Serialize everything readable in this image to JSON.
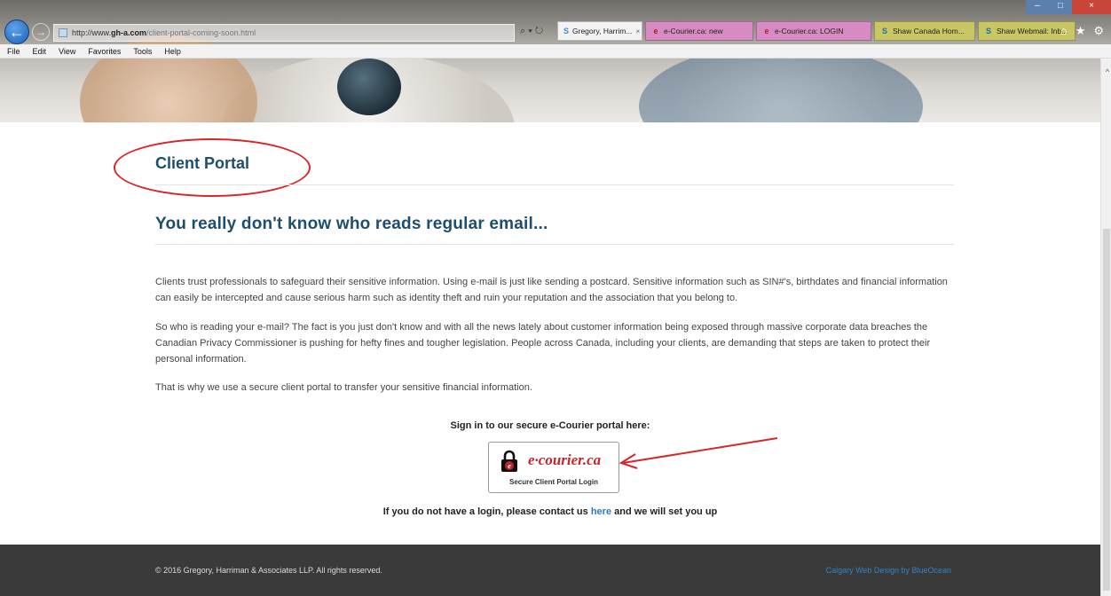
{
  "browser": {
    "url_scheme": "http://www.",
    "url_host": "gh-a.com",
    "url_path": "/client-portal-coming-soon.html",
    "tabs": [
      {
        "label": "Gregory, Harrim...",
        "icon": "S",
        "close": "×"
      },
      {
        "label": "e-Courier.ca: new",
        "icon": "e"
      },
      {
        "label": "e-Courier.ca: LOGIN",
        "icon": "e"
      },
      {
        "label": "Shaw Canada Hom...",
        "icon": "S"
      },
      {
        "label": "Shaw Webmail: Inb...",
        "icon": "S"
      }
    ],
    "menu": [
      "File",
      "Edit",
      "View",
      "Favorites",
      "Tools",
      "Help"
    ],
    "address_tools": "⌕ ▾ ↻",
    "right_icons": {
      "home": "⌂",
      "favorites": "★",
      "settings": "⚙"
    },
    "window_controls": {
      "minimize": "–",
      "maximize": "□",
      "close": "×"
    }
  },
  "page": {
    "portal_title": "Client Portal",
    "headline": "You really don't know who reads regular email...",
    "paragraphs": [
      "Clients trust professionals to safeguard their sensitive information. Using e-mail is just like sending a postcard. Sensitive information such as SIN#'s, birthdates and financial information can easily be intercepted and cause serious harm such as identity theft and ruin your reputation and the association that you belong to.",
      "So who is reading your e-mail? The fact is you just don't know and with all the news lately about customer information being exposed through massive corporate data breaches the Canadian Privacy Commissioner is pushing for hefty fines and tougher legislation. People across Canada, including your clients, are demanding that steps are taken to protect their personal information.",
      "That is why we use a secure client portal to transfer your sensitive financial information."
    ],
    "signin_prompt": "Sign in to our secure e-Courier portal here:",
    "ecourier": {
      "brand": "e·courier.ca",
      "subtitle": "Secure Client Portal Login"
    },
    "contact": {
      "before": "If you do not have a login, please contact  us ",
      "link": "here",
      "after": "  and we will set you up"
    }
  },
  "footer": {
    "copyright": "© 2016 Gregory, Harriman & Associates LLP. All rights reserved.",
    "credit": "Calgary Web Design by BlueOcean"
  },
  "colors": {
    "heading": "#1d4e6e",
    "annotation": "#d9262b",
    "link": "#2a7ac8",
    "footer_bg": "#3a3a3a"
  }
}
